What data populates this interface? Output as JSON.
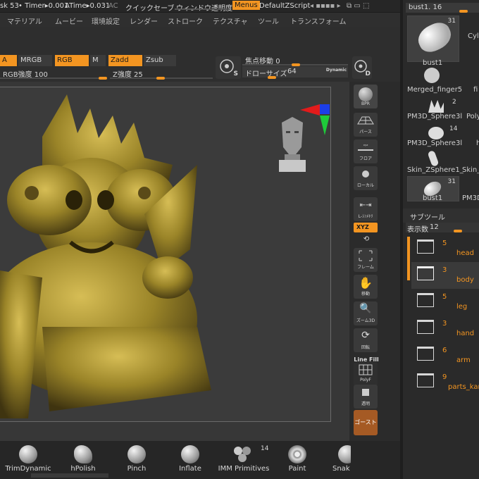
{
  "topbar": {
    "project": "sk 53",
    "timer": "• Timer▸0.001",
    "atime": "ATime▸0.031",
    "ac": "AC",
    "quicksave": "クイックセーブ",
    "window_transparency": "ウィンドウ透明度",
    "menus": "Menus",
    "default_zscript": "DefaultZScript"
  },
  "menubar": {
    "items": [
      "マテリアル",
      "ムービー",
      "環境設定",
      "レンダー",
      "ストローク",
      "テクスチャ",
      "ツール",
      "トランスフォーム"
    ]
  },
  "toolbar": {
    "a": "A",
    "mrgb": "MRGB",
    "rgb": "RGB",
    "m": "M",
    "zadd": "Zadd",
    "zsub": "Zsub",
    "rgb_intensity_label": "RGB強度",
    "rgb_intensity": "100",
    "z_intensity_label": "Z強度",
    "z_intensity": "25",
    "focal_shift_label": "焦点移動",
    "focal_shift": "0",
    "draw_size_label": "ドローサイズ",
    "draw_size": "64",
    "dynamic": "Dynamic",
    "s_icon_letter": "S",
    "d_icon_letter": "D"
  },
  "right_tools": {
    "bpr": "BPR",
    "perspective": "パース",
    "floor": "フロア",
    "local": "ローカル",
    "lsym": "L-ｼﾝﾒﾄﾘ",
    "xyz": "XYZ",
    "frame": "フレーム",
    "move": "移動",
    "zoom3d": "ズーム3D",
    "rotate": "回転",
    "line_fill": "Line Fill",
    "polyf": "PolyF",
    "transp": "透明",
    "ghost": "ゴースト",
    "solo": "ソロ"
  },
  "bottom_brushes": [
    {
      "label": "TrimDynamic"
    },
    {
      "label": "hPolish"
    },
    {
      "label": "Pinch"
    },
    {
      "label": "Inflate"
    },
    {
      "label": "IMM Primitives",
      "count": "14"
    },
    {
      "label": "Paint"
    },
    {
      "label": "Snak"
    }
  ],
  "tool_panel": {
    "current": "bust1. 16",
    "thumbs": [
      {
        "label": "bust1",
        "count": "31"
      },
      {
        "label": "Cyl",
        "count": ""
      },
      {
        "label": "Merged_finger5",
        "count": ""
      },
      {
        "label": "fi",
        "count": ""
      },
      {
        "label": "PM3D_Sphere3l",
        "count": "2"
      },
      {
        "label": "Poly",
        "count": ""
      },
      {
        "label": "PM3D_Sphere3l",
        "count": "14"
      },
      {
        "label": "h",
        "count": ""
      },
      {
        "label": "Skin_ZSphere1_",
        "count": ""
      },
      {
        "label": "Skin_",
        "count": ""
      },
      {
        "label": "bust1",
        "count": "31"
      },
      {
        "label": "PM3D",
        "count": ""
      }
    ]
  },
  "subtool": {
    "title": "サブツール",
    "count_label": "表示数",
    "count": "12",
    "items": [
      {
        "num": "5",
        "name": "head"
      },
      {
        "num": "3",
        "name": "body"
      },
      {
        "num": "5",
        "name": "leg"
      },
      {
        "num": "3",
        "name": "hand"
      },
      {
        "num": "6",
        "name": "arm"
      },
      {
        "num": "9",
        "name": "parts_kar"
      }
    ]
  },
  "colors": {
    "accent": "#f39521",
    "bronze": "#9a8428",
    "panel": "#2b2b2b"
  }
}
